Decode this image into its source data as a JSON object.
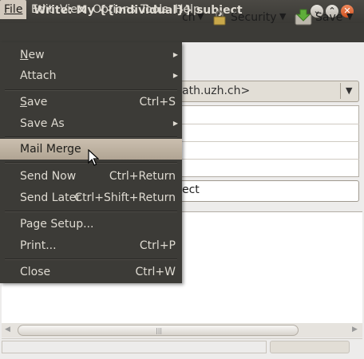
{
  "window": {
    "title": "Write: My {{individual}} subject"
  },
  "menubar": {
    "items": [
      "File",
      "Edit",
      "View",
      "Options",
      "Tools",
      "Help"
    ]
  },
  "toolbar": {
    "attach_partial": "ch",
    "security_label": "Security",
    "save_label": "Save"
  },
  "compose": {
    "from_partial": "ath.uzh.ch>",
    "subject_partial": "ect"
  },
  "file_menu": {
    "items": [
      {
        "label": "New",
        "mnemonic": "N",
        "rest": "ew",
        "shortcut": "",
        "submenu": true
      },
      {
        "label": "Attach",
        "mnemonic": "",
        "rest": "Attach",
        "shortcut": "",
        "submenu": true
      },
      {
        "label": "Save",
        "mnemonic": "S",
        "rest": "ave",
        "shortcut": "Ctrl+S",
        "submenu": false
      },
      {
        "label": "Save As",
        "mnemonic": "",
        "rest": "Save As",
        "shortcut": "",
        "submenu": true
      },
      {
        "label": "Mail Merge",
        "highlighted": true,
        "shortcut": "",
        "submenu": false
      },
      {
        "label": "Send Now",
        "shortcut": "Ctrl+Return",
        "submenu": false
      },
      {
        "label": "Send Later",
        "shortcut": "Ctrl+Shift+Return",
        "submenu": false
      },
      {
        "label": "Page Setup...",
        "shortcut": "",
        "submenu": false
      },
      {
        "label": "Print...",
        "shortcut": "Ctrl+P",
        "submenu": false
      },
      {
        "label": "Close",
        "shortcut": "Ctrl+W",
        "submenu": false
      }
    ]
  },
  "colors": {
    "menu_bg": "#3c3b37",
    "menu_text": "#dfdbd2",
    "highlight": "#b8ab99",
    "close_button": "#e06a3c"
  }
}
